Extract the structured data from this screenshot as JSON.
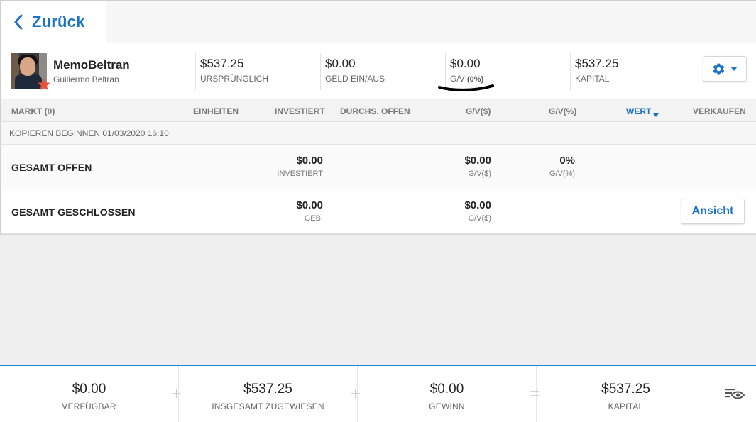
{
  "nav": {
    "back_label": "Zurück"
  },
  "profile": {
    "username": "MemoBeltran",
    "full_name": "Guillermo Beltran",
    "stats": [
      {
        "value": "$537.25",
        "label": "URSPRÜNGLICH"
      },
      {
        "value": "$0.00",
        "label": "GELD EIN/AUS"
      },
      {
        "value": "$0.00",
        "label": "G/V",
        "label_suffix": "(0%)"
      },
      {
        "value": "$537.25",
        "label": "KAPITAL"
      }
    ]
  },
  "table": {
    "headers": {
      "market": "MARKT (0)",
      "units": "EINHEITEN",
      "invested": "INVESTIERT",
      "avg_open": "DURCHS. OFFEN",
      "pl_usd": "G/V($)",
      "pl_pct": "G/V(%)",
      "value": "WERT",
      "sell": "VERKAUFEN"
    },
    "copy_started": "KOPIEREN BEGINNEN 01/03/2020 16:10",
    "total_open": {
      "title": "GESAMT OFFEN",
      "invested_value": "$0.00",
      "invested_label": "INVESTIERT",
      "pl_usd_value": "$0.00",
      "pl_usd_label": "G/V($)",
      "pl_pct_value": "0%",
      "pl_pct_label": "G/V(%)"
    },
    "total_closed": {
      "title": "GESAMT GESCHLOSSEN",
      "fees_value": "$0.00",
      "fees_label": "GEB.",
      "pl_usd_value": "$0.00",
      "pl_usd_label": "G/V($)",
      "view_button": "Ansicht"
    }
  },
  "footer": {
    "items": [
      {
        "value": "$0.00",
        "label": "VERFÜGBAR"
      },
      {
        "value": "$537.25",
        "label": "INSGESAMT ZUGEWIESEN"
      },
      {
        "value": "$0.00",
        "label": "GEWINN"
      },
      {
        "value": "$537.25",
        "label": "KAPITAL"
      }
    ],
    "operators": [
      "+",
      "+",
      "="
    ]
  },
  "icons": {
    "back": "chevron-left-icon",
    "settings": "gear-icon",
    "dropdown": "caret-down-icon",
    "star": "star-icon",
    "visibility": "eye-list-icon"
  },
  "colors": {
    "accent": "#1a72c9",
    "footer_border": "#1a88d6",
    "star": "#e8503a"
  }
}
